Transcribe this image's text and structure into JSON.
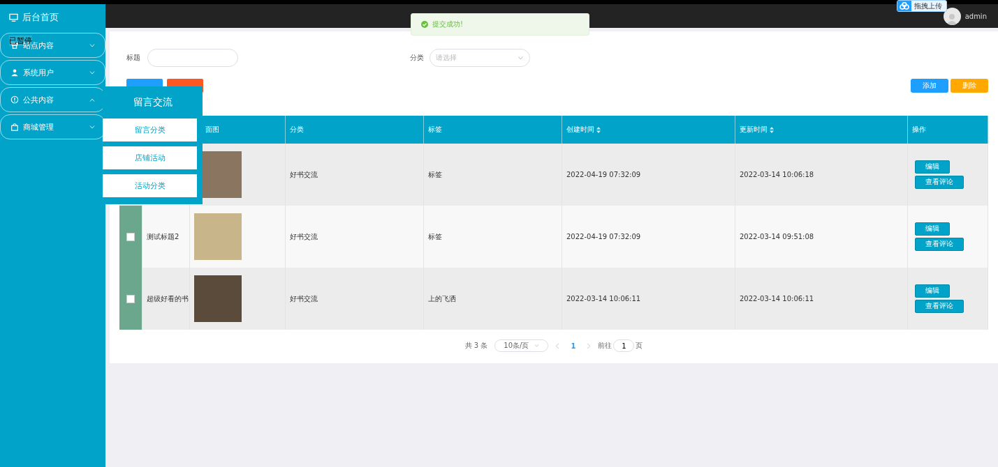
{
  "overlay_label": "已暂停",
  "sidebar": {
    "home": "后台首页",
    "groups": [
      {
        "label": "站点内容",
        "expanded": false
      },
      {
        "label": "系统用户",
        "expanded": false
      },
      {
        "label": "公共内容",
        "expanded": true
      },
      {
        "label": "商城管理",
        "expanded": false
      }
    ]
  },
  "flyout": {
    "title": "留言交流",
    "items": [
      "留言分类",
      "店铺活动",
      "活动分类"
    ]
  },
  "header": {
    "upload_badge": "拖拽上传",
    "user": "admin"
  },
  "toast": {
    "text": "提交成功!"
  },
  "filters": {
    "title_label": "标题",
    "category_label": "分类",
    "category_placeholder": "请选择"
  },
  "filter_buttons": [
    {
      "kind": "primary"
    },
    {
      "kind": "danger"
    }
  ],
  "actions": [
    {
      "label": "添加",
      "kind": "primary"
    },
    {
      "label": "删除",
      "kind": "warning"
    }
  ],
  "table": {
    "columns": [
      {
        "label": "面图",
        "sortable": false
      },
      {
        "label": "分类",
        "sortable": false
      },
      {
        "label": "标签",
        "sortable": false
      },
      {
        "label": "创建时间",
        "sortable": true
      },
      {
        "label": "更新时间",
        "sortable": true
      },
      {
        "label": "操作",
        "sortable": false
      }
    ],
    "rows": [
      {
        "category": "好书交流",
        "tag": "标签",
        "created": "2022-04-19 07:32:09",
        "updated": "2022-03-14 10:06:18",
        "actions": [
          "编辑",
          "查看评论"
        ]
      },
      {
        "checked": false,
        "title": "测试标题2",
        "category": "好书交流",
        "tag": "标签",
        "created": "2022-04-19 07:32:09",
        "updated": "2022-03-14 09:51:08",
        "actions": [
          "编辑",
          "查看评论"
        ]
      },
      {
        "checked": false,
        "title": "超级好看的书",
        "category": "好书交流",
        "tag": "上的飞洒",
        "created": "2022-03-14 10:06:11",
        "updated": "2022-03-14 10:06:11",
        "actions": [
          "编辑",
          "查看评论"
        ]
      }
    ]
  },
  "pagination": {
    "total": "共 3 条",
    "page_size": "10条/页",
    "pages": [
      {
        "label": "1",
        "selected": true
      }
    ],
    "jump_label": "前往",
    "jump_value": "1",
    "page_unit": "页"
  }
}
